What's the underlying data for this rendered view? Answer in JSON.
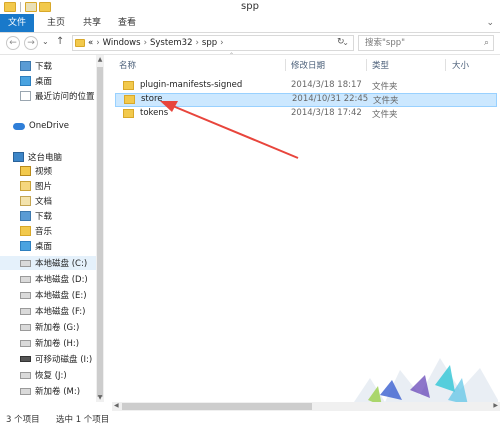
{
  "window": {
    "title": "spp"
  },
  "ribbon": {
    "file": "文件",
    "home": "主页",
    "share": "共享",
    "view": "查看"
  },
  "address": {
    "root": "«",
    "parts": [
      "Windows",
      "System32",
      "spp"
    ]
  },
  "search": {
    "placeholder": "搜索\"spp\""
  },
  "navpane": {
    "items": [
      {
        "label": "下载",
        "icon": "download-folder-icon"
      },
      {
        "label": "桌面",
        "icon": "desktop-icon"
      },
      {
        "label": "最近访问的位置",
        "icon": "recent-places-icon"
      },
      {
        "label": "OneDrive",
        "icon": "onedrive-icon"
      },
      {
        "label": "这台电脑",
        "icon": "this-pc-icon"
      },
      {
        "label": "视频",
        "icon": "videos-icon"
      },
      {
        "label": "图片",
        "icon": "pictures-icon"
      },
      {
        "label": "文档",
        "icon": "documents-icon"
      },
      {
        "label": "下载",
        "icon": "downloads-icon"
      },
      {
        "label": "音乐",
        "icon": "music-icon"
      },
      {
        "label": "桌面",
        "icon": "desktop-icon"
      },
      {
        "label": "本地磁盘 (C:)",
        "icon": "drive-icon"
      },
      {
        "label": "本地磁盘 (D:)",
        "icon": "drive-icon"
      },
      {
        "label": "本地磁盘 (E:)",
        "icon": "drive-icon"
      },
      {
        "label": "本地磁盘 (F:)",
        "icon": "drive-icon"
      },
      {
        "label": "新加卷 (G:)",
        "icon": "drive-icon"
      },
      {
        "label": "新加卷 (H:)",
        "icon": "drive-icon"
      },
      {
        "label": "可移动磁盘 (I:)",
        "icon": "usb-drive-icon"
      },
      {
        "label": "恢复 (J:)",
        "icon": "drive-icon"
      },
      {
        "label": "新加卷 (M:)",
        "icon": "drive-icon"
      }
    ]
  },
  "columns": {
    "name": "名称",
    "date": "修改日期",
    "type": "类型",
    "size": "大小"
  },
  "files": [
    {
      "name": "plugin-manifests-signed",
      "date": "2014/3/18 18:17",
      "type": "文件夹"
    },
    {
      "name": "store",
      "date": "2014/10/31 22:45",
      "type": "文件夹",
      "selected": true
    },
    {
      "name": "tokens",
      "date": "2014/3/18 17:42",
      "type": "文件夹"
    }
  ],
  "status": {
    "count": "3 个项目",
    "selected": "选中 1 个项目"
  },
  "colors": {
    "accent": "#1979ca",
    "selection": "#cce8ff",
    "annotation_arrow": "#e8453c"
  }
}
